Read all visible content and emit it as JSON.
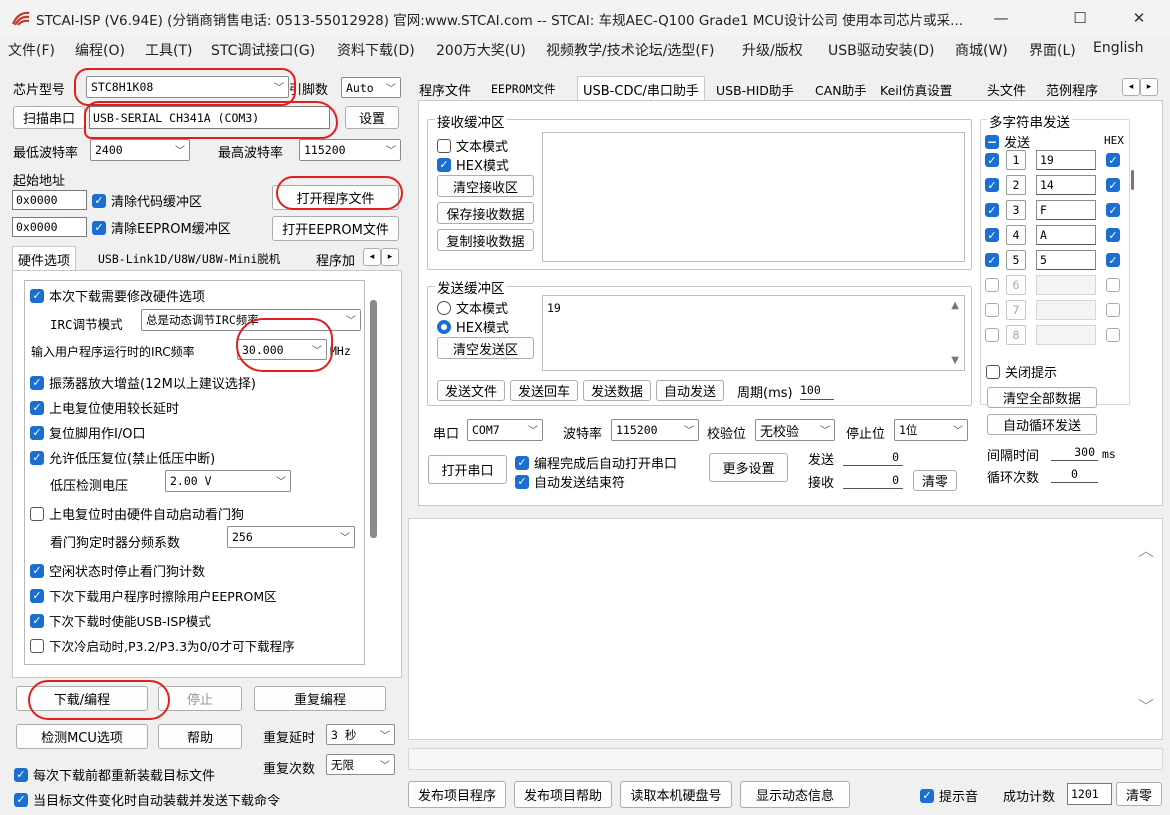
{
  "window": {
    "title": "STCAI-ISP (V6.94E) (分销商销售电话: 0513-55012928) 官网:www.STCAI.com  -- STCAI: 车规AEC-Q100 Grade1 MCU设计公司 使用本司芯片或采...",
    "minimize": "—",
    "maximize": "☐",
    "close": "✕"
  },
  "menu": [
    "文件(F)",
    "编程(O)",
    "工具(T)",
    "STC调试接口(G)",
    "资料下载(D)",
    "200万大奖(U)",
    "视频教学/技术论坛/选型(F)",
    "升级/版权",
    "USB驱动安装(D)",
    "商城(W)",
    "界面(L)",
    "English"
  ],
  "left": {
    "chip_label": "芯片型号",
    "chip_value": "STC8H1K08",
    "pins_label": "引脚数",
    "pins_value": "Auto",
    "scan_button": "扫描串口",
    "port_value": "USB-SERIAL CH341A (COM3)",
    "settings_button": "设置",
    "min_baud_label": "最低波特率",
    "min_baud_value": "2400",
    "max_baud_label": "最高波特率",
    "max_baud_value": "115200",
    "start_addr_label": "起始地址",
    "addr1": "0x0000",
    "clear_code": "清除代码缓冲区",
    "open_program": "打开程序文件",
    "addr2": "0x0000",
    "clear_eeprom": "清除EEPROM缓冲区",
    "open_eeprom": "打开EEPROM文件",
    "tabs": [
      "硬件选项",
      "USB-Link1D/U8W/U8W-Mini脱机",
      "程序加"
    ],
    "hw": {
      "modify_hw": "本次下载需要修改硬件选项",
      "irc_mode_label": "IRC调节模式",
      "irc_mode_value": "总是动态调节IRC频率",
      "irc_freq_label": "输入用户程序运行时的IRC频率",
      "irc_freq_value": "30.000",
      "irc_unit": "MHz",
      "osc_gain": "振荡器放大增益(12M以上建议选择)",
      "long_delay": "上电复位使用较长延时",
      "reset_io": "复位脚用作I/O口",
      "low_volt_reset": "允许低压复位(禁止低压中断)",
      "lv_detect_label": "低压检测电压",
      "lv_detect_value": "2.00 V",
      "wdt_hw": "上电复位时由硬件自动启动看门狗",
      "wdt_div_label": "看门狗定时器分频系数",
      "wdt_div_value": "256",
      "idle_wdt": "空闲状态时停止看门狗计数",
      "erase_eeprom": "下次下载用户程序时擦除用户EEPROM区",
      "usb_isp": "下次下载时使能USB-ISP模式",
      "cold_boot": "下次冷启动时,P3.2/P3.3为0/0才可下载程序"
    },
    "download_button": "下载/编程",
    "stop_button": "停止",
    "reprogram_button": "重复编程",
    "detect_button": "检测MCU选项",
    "help_button": "帮助",
    "repeat_delay_label": "重复延时",
    "repeat_delay_value": "3 秒",
    "repeat_count_label": "重复次数",
    "repeat_count_value": "无限",
    "reload_each": "每次下载前都重新装载目标文件",
    "auto_reload": "当目标文件变化时自动装载并发送下载命令"
  },
  "right": {
    "tabs": [
      "程序文件",
      "EEPROM文件",
      "USB-CDC/串口助手",
      "USB-HID助手",
      "CAN助手",
      "Keil仿真设置",
      "头文件",
      "范例程序"
    ],
    "recv": {
      "title": "接收缓冲区",
      "text_mode": "文本模式",
      "hex_mode": "HEX模式",
      "clear": "清空接收区",
      "save": "保存接收数据",
      "copy": "复制接收数据"
    },
    "send": {
      "title": "发送缓冲区",
      "text_mode": "文本模式",
      "hex_mode": "HEX模式",
      "clear": "清空发送区",
      "content": "19",
      "send_file": "发送文件",
      "send_cr": "发送回车",
      "send_data": "发送数据",
      "auto_send": "自动发送",
      "period_label": "周期(ms)",
      "period_value": "100"
    },
    "port_label": "串口",
    "port_value": "COM7",
    "baud_label": "波特率",
    "baud_value": "115200",
    "parity_label": "校验位",
    "parity_value": "无校验",
    "stopbit_label": "停止位",
    "stopbit_value": "1位",
    "open_port": "打开串口",
    "auto_open": "编程完成后自动打开串口",
    "auto_end": "自动发送结束符",
    "more_settings": "更多设置",
    "sent_label": "发送",
    "sent_value": "0",
    "recv_label": "接收",
    "recv_value": "0",
    "clear_count": "清零",
    "multi": {
      "title": "多字符串发送",
      "send_header": "发送",
      "hex_header": "HEX",
      "rows": [
        {
          "num": "1",
          "value": "19",
          "enabled": true,
          "hex": true
        },
        {
          "num": "2",
          "value": "14",
          "enabled": true,
          "hex": true
        },
        {
          "num": "3",
          "value": "F",
          "enabled": true,
          "hex": true
        },
        {
          "num": "4",
          "value": "A",
          "enabled": true,
          "hex": true
        },
        {
          "num": "5",
          "value": "5",
          "enabled": true,
          "hex": true
        },
        {
          "num": "6",
          "value": "",
          "enabled": false,
          "hex": false
        },
        {
          "num": "7",
          "value": "",
          "enabled": false,
          "hex": false
        },
        {
          "num": "8",
          "value": "",
          "enabled": false,
          "hex": false
        }
      ],
      "close_tip": "关闭提示",
      "clear_all": "清空全部数据",
      "auto_loop": "自动循环发送",
      "interval_label": "间隔时间",
      "interval_value": "300",
      "interval_unit": "ms",
      "loop_label": "循环次数",
      "loop_value": "0"
    }
  },
  "bottom": {
    "publish_program": "发布项目程序",
    "publish_help": "发布项目帮助",
    "read_disk": "读取本机硬盘号",
    "show_dynamic": "显示动态信息",
    "beep": "提示音",
    "success_label": "成功计数",
    "success_value": "1201",
    "clear": "清零"
  },
  "colors": {
    "accent": "#1a6fd1",
    "annotation": "#e02020"
  }
}
